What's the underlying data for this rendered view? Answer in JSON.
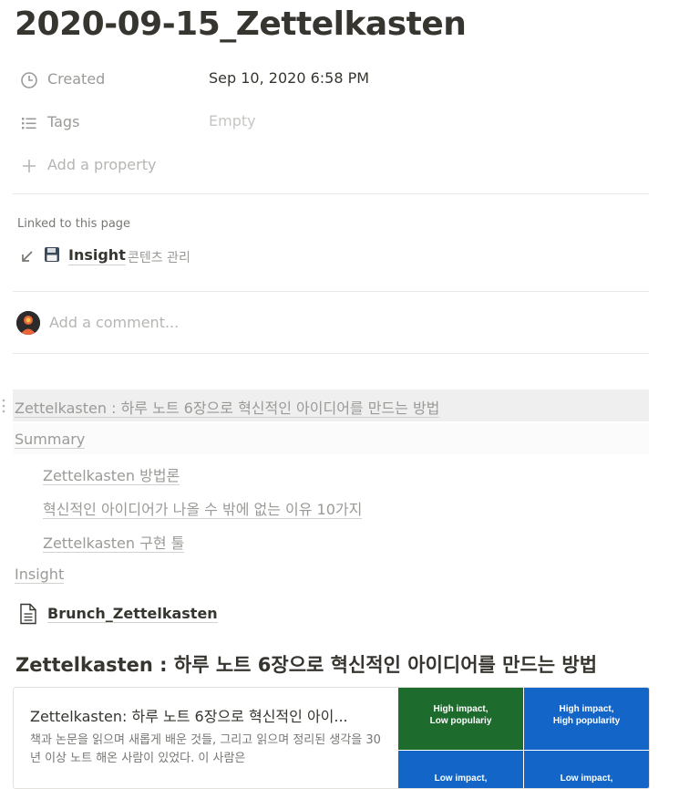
{
  "title": "2020-09-15_Zettelkasten",
  "properties": {
    "created": {
      "label": "Created",
      "value": "Sep 10, 2020 6:58 PM"
    },
    "tags": {
      "label": "Tags",
      "value": "Empty"
    },
    "add": {
      "label": "Add a property"
    }
  },
  "linked": {
    "label": "Linked to this page",
    "item": {
      "name": "Insight",
      "sub": "콘텐츠 관리"
    }
  },
  "comment": {
    "placeholder": "Add a comment..."
  },
  "toc": [
    {
      "text": "Zettelkasten : 하루 노트 6장으로 혁신적인 아이디어를 만드는 방법"
    },
    {
      "text": "Summary"
    },
    {
      "text": "Zettelkasten 방법론"
    },
    {
      "text": "혁신적인 아이디어가 나올 수 밖에 없는 이유 10가지"
    },
    {
      "text": "Zettelkasten 구현 툴"
    },
    {
      "text": "Insight"
    }
  ],
  "doc_link": {
    "name": "Brunch_Zettelkasten"
  },
  "heading": "Zettelkasten : 하루 노트 6장으로 혁신적인 아이디어를 만드는 방법",
  "bookmark": {
    "title": "Zettelkasten: 하루 노트 6장으로 혁신적인 아이...",
    "description": "책과 논문을 읽으며 새롭게 배운 것들, 그리고 읽으며 정리된 생각을 30년 이상 노트 해온 사람이 있었다. 이 사람은",
    "thumb": {
      "cells": [
        {
          "text": "High impact,\nLow populariy",
          "color": "#1e6b2e"
        },
        {
          "text": "High impact,\nHigh popularity",
          "color": "#1366c7"
        },
        {
          "text": "Low impact,",
          "color": "#1366c7"
        },
        {
          "text": "Low impact,",
          "color": "#1366c7"
        }
      ]
    }
  },
  "colors": {
    "text": "#37352f",
    "muted": "#9b9a97",
    "divider": "#e9e9e7",
    "highlight": "#efefef"
  }
}
